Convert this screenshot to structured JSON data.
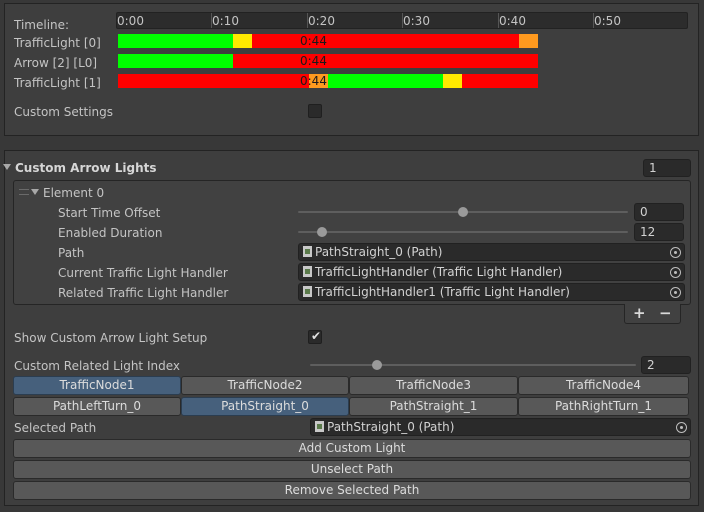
{
  "timeline": {
    "label": "Timeline:",
    "ticks": [
      "0:00",
      "0:10",
      "0:20",
      "0:30",
      "0:40",
      "0:50"
    ],
    "tracks": [
      {
        "label": "TrafficLight [0]",
        "time": "0:44"
      },
      {
        "label": "Arrow [2] [L0]",
        "time": "0:44"
      },
      {
        "label": "TrafficLight [1]",
        "time": "0:44"
      }
    ],
    "colors": {
      "green": "#00ff00",
      "red": "#ff0000",
      "yellow": "#ffea00",
      "orange": "#ff9a1f"
    }
  },
  "custom_settings": {
    "label": "Custom Settings",
    "checked": false
  },
  "arrow_lights": {
    "title": "Custom Arrow Lights",
    "count": "1",
    "element": {
      "title": "Element 0",
      "start_time_offset": {
        "label": "Start Time Offset",
        "value": "0"
      },
      "enabled_duration": {
        "label": "Enabled Duration",
        "value": "12"
      },
      "path": {
        "label": "Path",
        "value": "PathStraight_0 (Path)"
      },
      "current_handler": {
        "label": "Current Traffic Light Handler",
        "value": "TrafficLightHandler (Traffic Light Handler)"
      },
      "related_handler": {
        "label": "Related Traffic Light Handler",
        "value": "TrafficLightHandler1 (Traffic Light Handler)"
      }
    },
    "plus": "+",
    "minus": "−"
  },
  "show_setup": {
    "label": "Show Custom Arrow Light Setup",
    "checked": true
  },
  "related_index": {
    "label": "Custom Related Light Index",
    "value": "2"
  },
  "nodes": [
    "TrafficNode1",
    "TrafficNode2",
    "TrafficNode3",
    "TrafficNode4"
  ],
  "paths": [
    "PathLeftTurn_0",
    "PathStraight_0",
    "PathStraight_1",
    "PathRightTurn_1"
  ],
  "selected_path": {
    "label": "Selected Path",
    "value": "PathStraight_0 (Path)"
  },
  "actions": {
    "add": "Add Custom Light",
    "unselect": "Unselect Path",
    "remove": "Remove Selected Path"
  }
}
